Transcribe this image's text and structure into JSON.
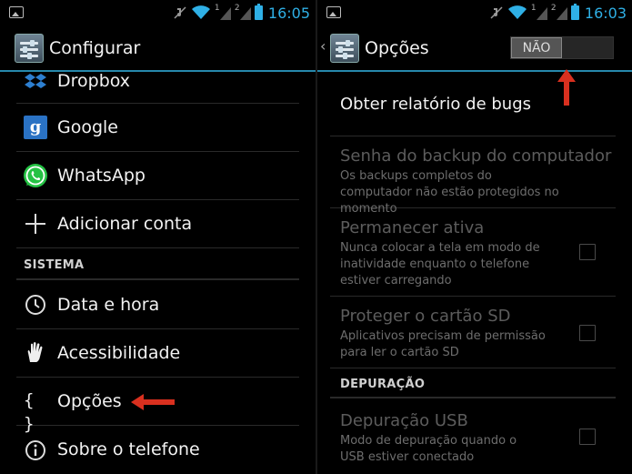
{
  "left": {
    "status": {
      "time": "16:05"
    },
    "header": {
      "title": "Configurar"
    },
    "items": [
      {
        "label": "Dropbox",
        "icon": "dropbox-icon"
      },
      {
        "label": "Google",
        "icon": "google-icon"
      },
      {
        "label": "WhatsApp",
        "icon": "whatsapp-icon"
      },
      {
        "label": "Adicionar conta",
        "icon": "plus-icon"
      }
    ],
    "section": "SISTEMA",
    "system_items": [
      {
        "label": "Data e hora",
        "icon": "clock-icon"
      },
      {
        "label": "Acessibilidade",
        "icon": "hand-icon"
      },
      {
        "label": "Opções",
        "icon": "braces-icon"
      },
      {
        "label": "Sobre o telefone",
        "icon": "info-icon"
      }
    ]
  },
  "right": {
    "status": {
      "time": "16:03"
    },
    "header": {
      "title": "Opções",
      "toggle_label": "NÃO"
    },
    "items": [
      {
        "title": "Obter relatório de bugs"
      },
      {
        "title": "Senha do backup do computador",
        "subtitle": "Os backups completos do computador não estão protegidos no momento"
      },
      {
        "title": "Permanecer ativa",
        "subtitle": "Nunca colocar a tela em modo de inatividade enquanto o telefone estiver carregando"
      },
      {
        "title": "Proteger o cartão SD",
        "subtitle": "Aplicativos precisam de permissão para ler o cartão SD"
      }
    ],
    "section": "DEPURAÇÃO",
    "debug_items": [
      {
        "title": "Depuração USB",
        "subtitle": "Modo de depuração quando o USB estiver conectado"
      }
    ]
  },
  "colors": {
    "accent": "#33b5e5",
    "arrow": "#d9301f",
    "time": "#2fb0e6",
    "whatsapp": "#25c244",
    "google": "#2a72c4"
  }
}
